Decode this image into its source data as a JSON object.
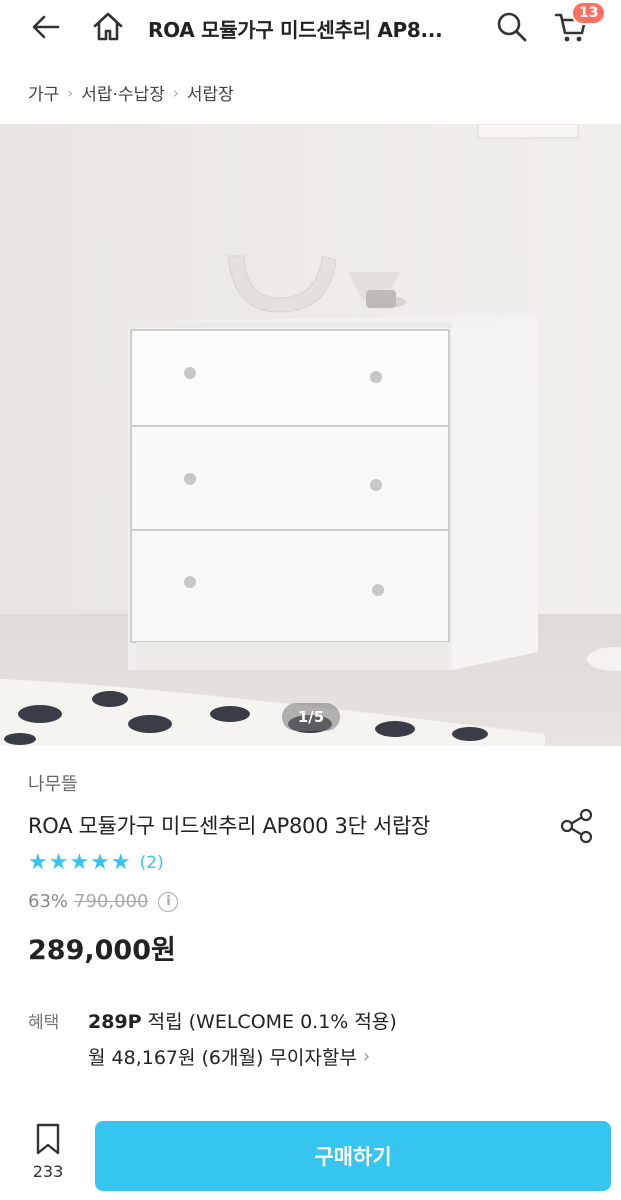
{
  "header": {
    "back_icon": "back-arrow-icon",
    "home_icon": "home-icon",
    "title": "ROA 모듈가구 미드센추리 AP8...",
    "search_icon": "search-icon",
    "cart_icon": "cart-icon",
    "cart_count": "13"
  },
  "breadcrumb": {
    "items": [
      "가구",
      "서랍·수납장",
      "서랍장"
    ]
  },
  "gallery": {
    "counter": "1/5"
  },
  "product": {
    "brand": "나무뜰",
    "name": "ROA 모듈가구 미드센추리 AP800 3단 서랍장",
    "share_icon": "share-icon",
    "rating": 5,
    "stars": "★★★★★",
    "review_count": "(2)",
    "discount": "63%",
    "original_price": "790,000",
    "info_icon": "info-icon",
    "sale_price": "289,000원"
  },
  "benefits": {
    "label": "혜택",
    "points_bold": "289P",
    "points_rest": " 적립 (WELCOME 0.1% 적용)",
    "installment": "월 48,167원 (6개월) 무이자할부"
  },
  "bottom_bar": {
    "bookmark_icon": "bookmark-icon",
    "bookmark_count": "233",
    "buy_label": "구매하기"
  },
  "colors": {
    "accent": "#35c5f0",
    "badge": "#ff6f61"
  }
}
